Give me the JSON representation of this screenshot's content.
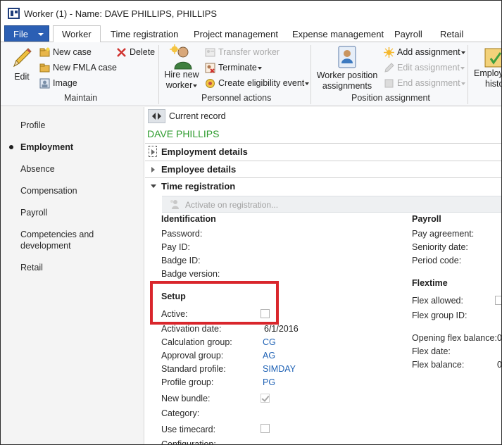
{
  "window": {
    "title": "Worker (1) - Name: DAVE PHILLIPS, PHILLIPS"
  },
  "tabs": {
    "file_label": "File",
    "items": [
      "Worker",
      "Time registration",
      "Project management",
      "Expense management",
      "Payroll",
      "Retail"
    ],
    "active": "Worker"
  },
  "ribbon": {
    "maintain": {
      "label": "Maintain",
      "edit": "Edit",
      "new_case": "New case",
      "new_fmla_case": "New FMLA case",
      "image": "Image",
      "delete": "Delete"
    },
    "personnel_actions": {
      "label": "Personnel actions",
      "hire_new_worker_line1": "Hire new",
      "hire_new_worker_line2": "worker",
      "transfer_worker": "Transfer worker",
      "terminate": "Terminate",
      "create_eligibility_event": "Create eligibility event"
    },
    "position_assignment": {
      "label": "Position assignment",
      "worker_position_line1": "Worker position",
      "worker_position_line2": "assignments",
      "add_assignment": "Add assignment",
      "edit_assignment": "Edit assignment",
      "end_assignment": "End assignment"
    },
    "overflow": {
      "line1": "Employ",
      "line2": "histo"
    }
  },
  "leftnav": {
    "items": [
      "Profile",
      "Employment",
      "Absence",
      "Compensation",
      "Payroll",
      "Competencies and",
      "development",
      "Retail"
    ],
    "active": "Employment"
  },
  "record": {
    "current_record_label": "Current record",
    "name": "DAVE PHILLIPS"
  },
  "fasttabs": {
    "employment_details": "Employment details",
    "employee_details": "Employee details",
    "time_registration": "Time registration"
  },
  "time_registration": {
    "activate_button": "Activate on registration...",
    "identification": {
      "heading": "Identification",
      "password": "Password:",
      "pay_id": "Pay ID:",
      "badge_id": "Badge ID:",
      "badge_version": "Badge version:"
    },
    "setup": {
      "heading": "Setup",
      "active_label": "Active:",
      "active_checked": false,
      "activation_date_label": "Activation date:",
      "activation_date": "6/1/2016",
      "calculation_group_label": "Calculation group:",
      "calculation_group": "CG",
      "approval_group_label": "Approval group:",
      "approval_group": "AG",
      "standard_profile_label": "Standard profile:",
      "standard_profile": "SIMDAY",
      "profile_group_label": "Profile group:",
      "profile_group": "PG",
      "new_bundle_label": "New bundle:",
      "new_bundle_checked": true,
      "category_label": "Category:",
      "use_timecard_label": "Use timecard:",
      "use_timecard_checked": false,
      "configuration_label": "Configuration:"
    },
    "payroll": {
      "heading": "Payroll",
      "pay_agreement": "Pay agreement:",
      "seniority_date": "Seniority date:",
      "period_code": "Period code:"
    },
    "flextime": {
      "heading": "Flextime",
      "flex_allowed": "Flex allowed:",
      "flex_group_id": "Flex group ID:",
      "opening_flex_balance": "Opening flex balance:",
      "opening_flex_balance_value": "0",
      "flex_date": "Flex date:",
      "flex_balance": "Flex balance:",
      "flex_balance_value": "0"
    }
  },
  "colors": {
    "file_button": "#2b5fb4",
    "record_name": "#2c9b2c",
    "link_value": "#1f62b5",
    "highlight_box": "#d9262c"
  }
}
